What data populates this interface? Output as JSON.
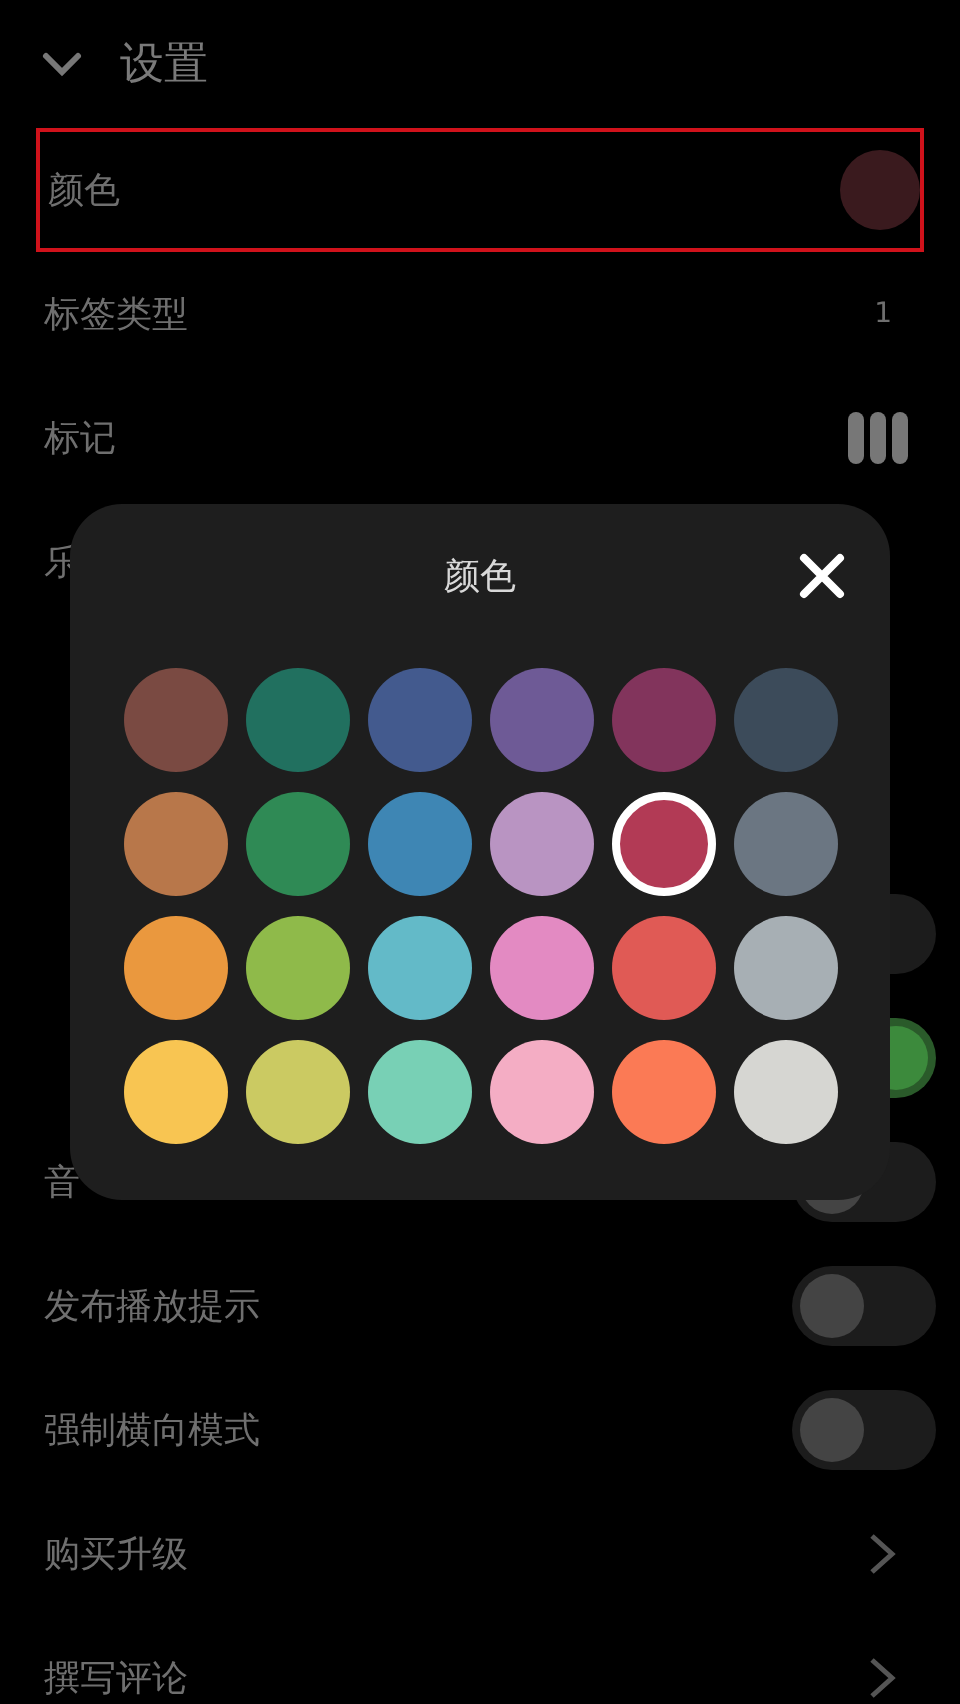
{
  "header": {
    "title": "设置",
    "expanded": true
  },
  "rows": [
    {
      "kind": "swatch",
      "label": "颜色",
      "color": "#3a1a1e",
      "highlighted": true
    },
    {
      "kind": "value",
      "label": "标签类型",
      "value": "1"
    },
    {
      "kind": "markers",
      "label": "标记"
    },
    {
      "kind": "plain",
      "label": "乐"
    },
    {
      "kind": "plain"
    },
    {
      "kind": "plain"
    },
    {
      "kind": "toggle",
      "on": false
    },
    {
      "kind": "toggle",
      "on": true
    },
    {
      "kind": "toggle",
      "label": "音",
      "on": false
    },
    {
      "kind": "toggle",
      "label": "发布播放提示",
      "on": false
    },
    {
      "kind": "toggle",
      "label": "强制横向模式",
      "on": false
    },
    {
      "kind": "chevron",
      "label": "购买升级"
    },
    {
      "kind": "chevron",
      "label": "撰写评论"
    }
  ],
  "dialog": {
    "title": "颜色",
    "swatches": [
      {
        "color": "#7a4a42",
        "selected": false
      },
      {
        "color": "#21705f",
        "selected": false
      },
      {
        "color": "#435a8e",
        "selected": false
      },
      {
        "color": "#6e5a96",
        "selected": false
      },
      {
        "color": "#82345c",
        "selected": false
      },
      {
        "color": "#3c4b5a",
        "selected": false
      },
      {
        "color": "#b8774a",
        "selected": false
      },
      {
        "color": "#2f8a55",
        "selected": false
      },
      {
        "color": "#3e86b4",
        "selected": false
      },
      {
        "color": "#b994c2",
        "selected": false
      },
      {
        "color": "#b23a55",
        "selected": true
      },
      {
        "color": "#6b7682",
        "selected": false
      },
      {
        "color": "#ea983e",
        "selected": false
      },
      {
        "color": "#8fba4a",
        "selected": false
      },
      {
        "color": "#63bac8",
        "selected": false
      },
      {
        "color": "#e38ac2",
        "selected": false
      },
      {
        "color": "#e05a55",
        "selected": false
      },
      {
        "color": "#a7afb4",
        "selected": false
      },
      {
        "color": "#f8c552",
        "selected": false
      },
      {
        "color": "#cbca62",
        "selected": false
      },
      {
        "color": "#78d0b5",
        "selected": false
      },
      {
        "color": "#f4adc4",
        "selected": false
      },
      {
        "color": "#fb7a55",
        "selected": false
      },
      {
        "color": "#d6d6d2",
        "selected": false
      }
    ]
  }
}
